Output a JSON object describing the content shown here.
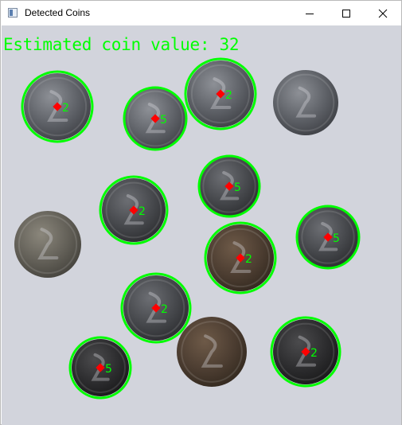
{
  "window": {
    "title": "Detected Coins",
    "controls": {
      "minimize_icon": "minimize-icon",
      "maximize_icon": "maximize-icon",
      "close_icon": "close-icon"
    }
  },
  "overlay": {
    "estimate_label": "Estimated coin value: 32",
    "detection_color": "#00ff00",
    "center_color": "#ff0000"
  },
  "coins": [
    {
      "id": "c1",
      "value_label": "2",
      "detected": true,
      "metal": "silver"
    },
    {
      "id": "c2",
      "value_label": "5",
      "detected": true,
      "metal": "silver"
    },
    {
      "id": "c3",
      "value_label": "2",
      "detected": true,
      "metal": "silver"
    },
    {
      "id": "c4",
      "value_label": "",
      "detected": false,
      "metal": "silver"
    },
    {
      "id": "c5",
      "value_label": "2",
      "detected": true,
      "metal": "steel"
    },
    {
      "id": "c6",
      "value_label": "5",
      "detected": true,
      "metal": "steel"
    },
    {
      "id": "c7",
      "value_label": "",
      "detected": false,
      "metal": "nickel"
    },
    {
      "id": "c8",
      "value_label": "2",
      "detected": true,
      "metal": "bronze"
    },
    {
      "id": "c9",
      "value_label": "5",
      "detected": true,
      "metal": "steel"
    },
    {
      "id": "c10",
      "value_label": "2",
      "detected": true,
      "metal": "steel"
    },
    {
      "id": "c11",
      "value_label": "",
      "detected": false,
      "metal": "bronze"
    },
    {
      "id": "c12",
      "value_label": "2",
      "detected": true,
      "metal": "dark"
    },
    {
      "id": "c13",
      "value_label": "5",
      "detected": true,
      "metal": "dark"
    }
  ]
}
